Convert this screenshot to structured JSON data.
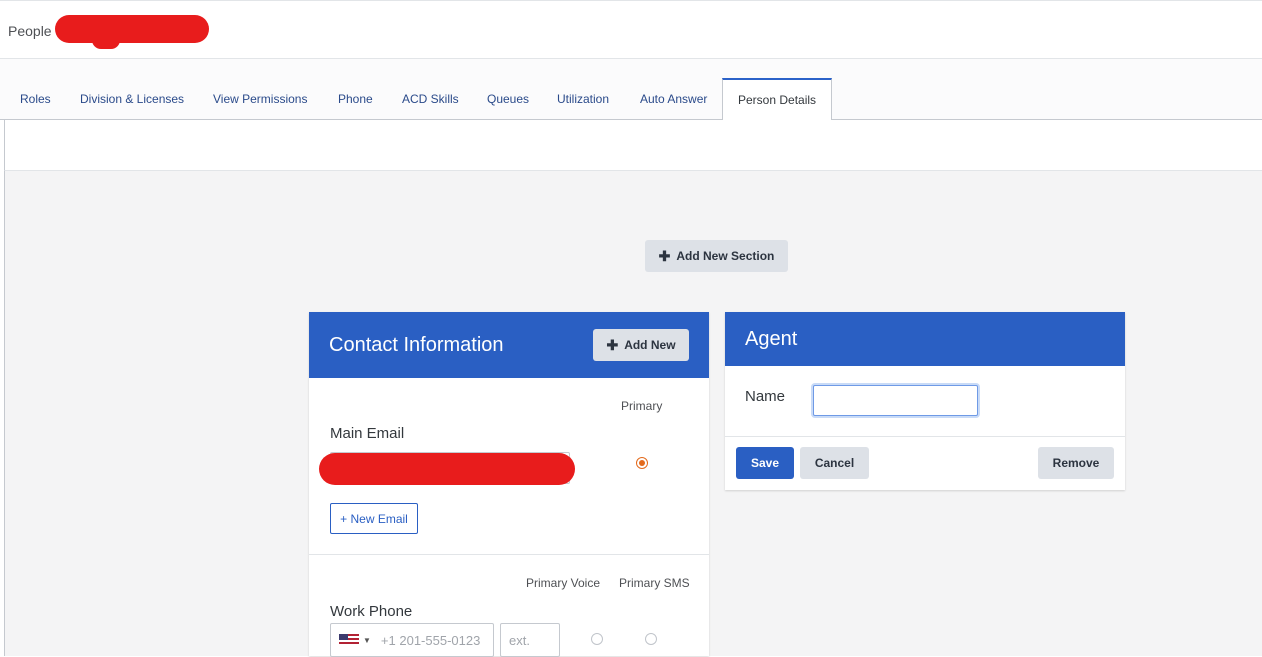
{
  "header": {
    "breadcrumb": "People"
  },
  "tabs": [
    {
      "label": "Roles"
    },
    {
      "label": "Division & Licenses"
    },
    {
      "label": "View Permissions"
    },
    {
      "label": "Phone"
    },
    {
      "label": "ACD Skills"
    },
    {
      "label": "Queues"
    },
    {
      "label": "Utilization"
    },
    {
      "label": "Auto Answer"
    },
    {
      "label": "Person Details"
    }
  ],
  "actions": {
    "add_section_label": "Add New Section"
  },
  "contact_card": {
    "title": "Contact Information",
    "add_new_label": "Add New",
    "email_section": {
      "label": "Main Email",
      "primary_header": "Primary",
      "new_email_label": "+ New Email"
    },
    "phone_section": {
      "label": "Work Phone",
      "primary_voice_header": "Primary Voice",
      "primary_sms_header": "Primary SMS",
      "phone_placeholder": "+1 201-555-0123",
      "ext_placeholder": "ext."
    }
  },
  "agent_card": {
    "title": "Agent",
    "name_label": "Name",
    "name_value": "",
    "save_label": "Save",
    "cancel_label": "Cancel",
    "remove_label": "Remove"
  },
  "colors": {
    "primary_blue": "#2a5fc3",
    "radio_selected": "#e36a1c",
    "content_bg": "#f4f4f5"
  }
}
